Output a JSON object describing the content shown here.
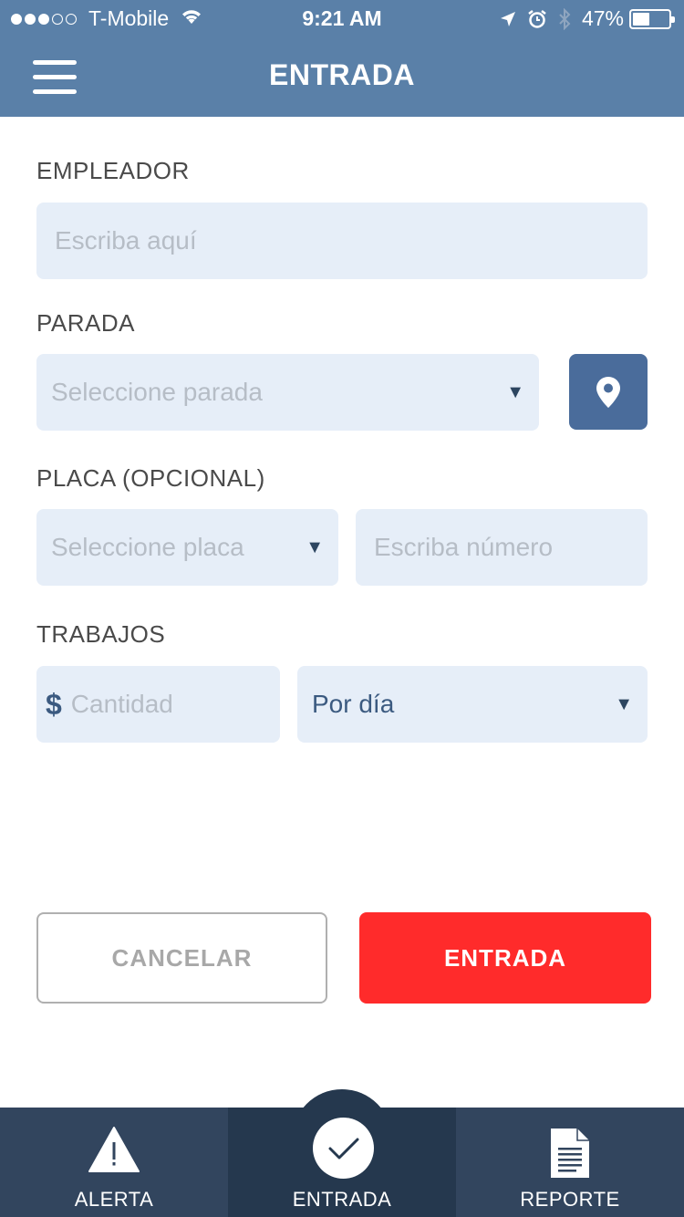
{
  "status_bar": {
    "carrier": "T-Mobile",
    "time": "9:21 AM",
    "battery_percent": "47%",
    "battery_level": 0.47,
    "signal_bars_filled": 3,
    "signal_bars_total": 5,
    "icons": [
      "wifi-icon",
      "location-arrow-icon",
      "alarm-icon",
      "bluetooth-icon",
      "battery-icon"
    ]
  },
  "header": {
    "title": "ENTRADA",
    "menu_icon": "hamburger-menu-icon",
    "background": "#5a80a8"
  },
  "form": {
    "employer": {
      "label": "EMPLEADOR",
      "value": "",
      "placeholder": "Escriba aquí"
    },
    "stop": {
      "label": "PARADA",
      "selected": "Seleccione parada",
      "location_icon": "map-pin-icon"
    },
    "plate": {
      "label": "PLACA (OPCIONAL)",
      "selected": "Seleccione placa",
      "number_value": "",
      "number_placeholder": "Escriba número"
    },
    "jobs": {
      "label": "TRABAJOS",
      "currency": "$",
      "amount_value": "",
      "amount_placeholder": "Cantidad",
      "period_selected": "Por día"
    }
  },
  "actions": {
    "cancel_label": "CANCELAR",
    "submit_label": "ENTRADA",
    "submit_color": "#ff2b2b"
  },
  "tabbar": {
    "active": "ENTRADA",
    "items": [
      {
        "label": "ALERTA",
        "icon": "alert-triangle-icon"
      },
      {
        "label": "ENTRADA",
        "icon": "checkmark-icon"
      },
      {
        "label": "REPORTE",
        "icon": "document-icon"
      }
    ],
    "background": "#32455e"
  }
}
